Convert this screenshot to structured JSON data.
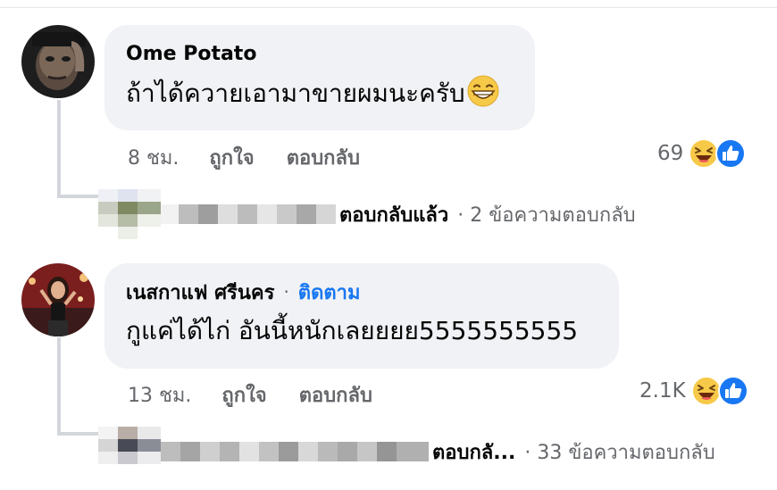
{
  "comments": [
    {
      "author": "Ome Potato",
      "text": "ถ้าได้ควายเอามาขายผมนะครับ",
      "emoji": "grinning-face-emoji",
      "time": "8 ชม.",
      "like_label": "ถูกใจ",
      "reply_label": "ตอบกลับ",
      "reaction_count": "69",
      "reaction_icons": [
        "haha-reaction-icon",
        "like-reaction-icon"
      ],
      "replied_label": "ตอบกลับแล้ว",
      "reply_summary": "· 2 ข้อความตอบกลับ"
    },
    {
      "author": "เนสกาแฟ ศรีนคร",
      "follow_separator": "·",
      "follow_label": "ติดตาม",
      "text": "กูแค่ได้ไก่ อันนี้หนักเลยยยย5555555555",
      "time": "13 ชม.",
      "like_label": "ถูกใจ",
      "reply_label": "ตอบกลับ",
      "reaction_count": "2.1K",
      "reaction_icons": [
        "haha-reaction-icon",
        "like-reaction-icon"
      ],
      "replied_label": "ตอบกลั...",
      "reply_summary": "· 33 ข้อความตอบกลับ"
    }
  ],
  "colors": {
    "bubble_bg": "#f0f2f5",
    "secondary_text": "#65676b",
    "link_blue": "#1877f2",
    "thread_line": "#d3d6db"
  }
}
